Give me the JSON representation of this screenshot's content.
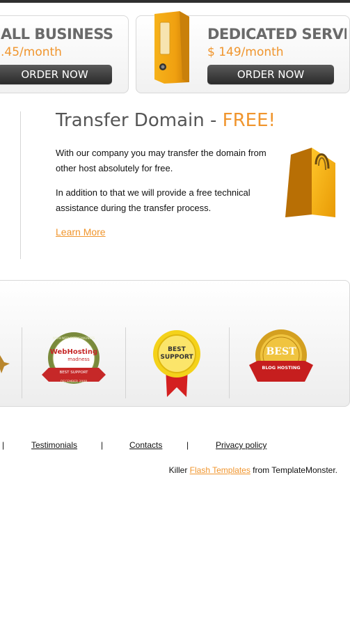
{
  "plans": [
    {
      "title": "ALL BUSINESS",
      "price": ".45/month",
      "button": "ORDER NOW"
    },
    {
      "title": "DEDICATED SERVER",
      "price": "$ 149/month",
      "button": "ORDER NOW"
    }
  ],
  "transfer": {
    "title": "Transfer Domain - ",
    "title_highlight": "FREE!",
    "paragraph1": "With our company you may transfer the domain from other host absolutely for free.",
    "paragraph2": "In addition to that we will provide a free technical assistance during the transfer process.",
    "learn_more": "Learn More"
  },
  "badges": [
    {
      "name": "webhosting-madness-badge",
      "main": "WebHosting",
      "sub": "madness",
      "ribbon": "BEST SUPPORT",
      "ring_top": "WWW.WEBHOSTINGMADNESS",
      "ring_bottom": "DECEMBER 2008"
    },
    {
      "name": "best-support-badge",
      "main": "BEST",
      "sub": "SUPPORT"
    },
    {
      "name": "best-blog-hosting-badge",
      "main": "BEST",
      "ribbon": "BLOG HOSTING"
    }
  ],
  "footer": {
    "separator": "|",
    "links": [
      "Testimonials",
      "Contacts",
      "Privacy policy"
    ],
    "credits_prefix": "Killer ",
    "credits_link": "Flash Templates",
    "credits_suffix": " from TemplateMonster."
  },
  "colors": {
    "accent": "#f0952d",
    "heading": "#555555",
    "button": "#333333"
  }
}
